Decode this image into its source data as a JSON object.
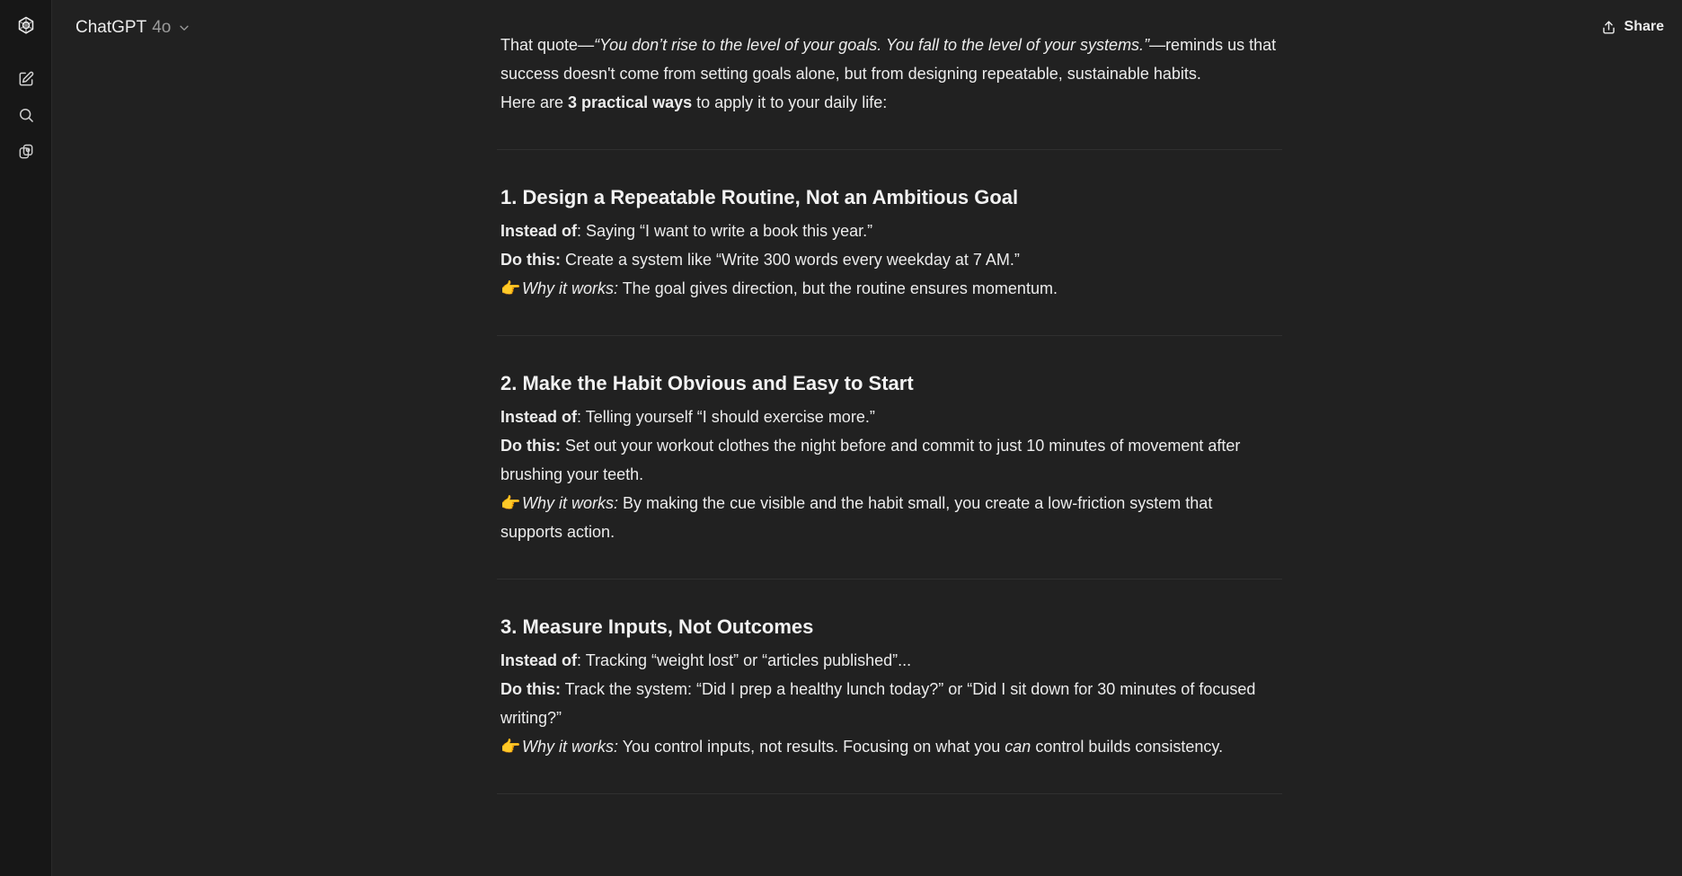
{
  "header": {
    "model_name": "ChatGPT",
    "model_version": "4o",
    "share_label": "Share"
  },
  "message": {
    "intro_prefix": "That quote—",
    "intro_quote": "“You don’t rise to the level of your goals. You fall to the level of your systems.”",
    "intro_suffix": "—reminds us that success doesn't come from setting goals alone, but from designing repeatable, sustainable habits.",
    "lead_prefix": "Here are ",
    "lead_bold": "3 practical ways",
    "lead_suffix": " to apply it to your daily life:",
    "sections": [
      {
        "heading": "1. Design a Repeatable Routine, Not an Ambitious Goal",
        "instead_label": "Instead of",
        "instead_text": ": Saying “I want to write a book this year.”",
        "do_label": "Do this:",
        "do_text": " Create a system like “Write 300 words every weekday at 7 AM.”",
        "emoji": "👉",
        "why_label": "Why it works:",
        "why_text": " The goal gives direction, but the routine ensures momentum."
      },
      {
        "heading": "2. Make the Habit Obvious and Easy to Start",
        "instead_label": "Instead of",
        "instead_text": ": Telling yourself “I should exercise more.”",
        "do_label": "Do this:",
        "do_text": " Set out your workout clothes the night before and commit to just 10 minutes of movement after brushing your teeth.",
        "emoji": "👉",
        "why_label": "Why it works:",
        "why_text": " By making the cue visible and the habit small, you create a low-friction system that supports action."
      },
      {
        "heading": "3. Measure Inputs, Not Outcomes",
        "instead_label": "Instead of",
        "instead_text": ": Tracking “weight lost” or “articles published”...",
        "do_label": "Do this:",
        "do_text": " Track the system: “Did I prep a healthy lunch today?” or “Did I sit down for 30 minutes of focused writing?”",
        "emoji": "👉",
        "why_label": "Why it works:",
        "why_text_before": " You control inputs, not results. Focusing on what you ",
        "why_text_em": "can",
        "why_text_after": " control builds consistency."
      }
    ]
  },
  "icons": {
    "logo": "openai-logo-icon",
    "new_chat": "new-chat-icon",
    "search": "search-icon",
    "gpts": "gpts-icon",
    "chevron": "chevron-down-icon",
    "share": "share-icon"
  },
  "colors": {
    "background": "#212121",
    "sidebar": "#171717",
    "text": "#ececec",
    "muted": "#9b9b9b",
    "emoji": "#f5b53a"
  }
}
